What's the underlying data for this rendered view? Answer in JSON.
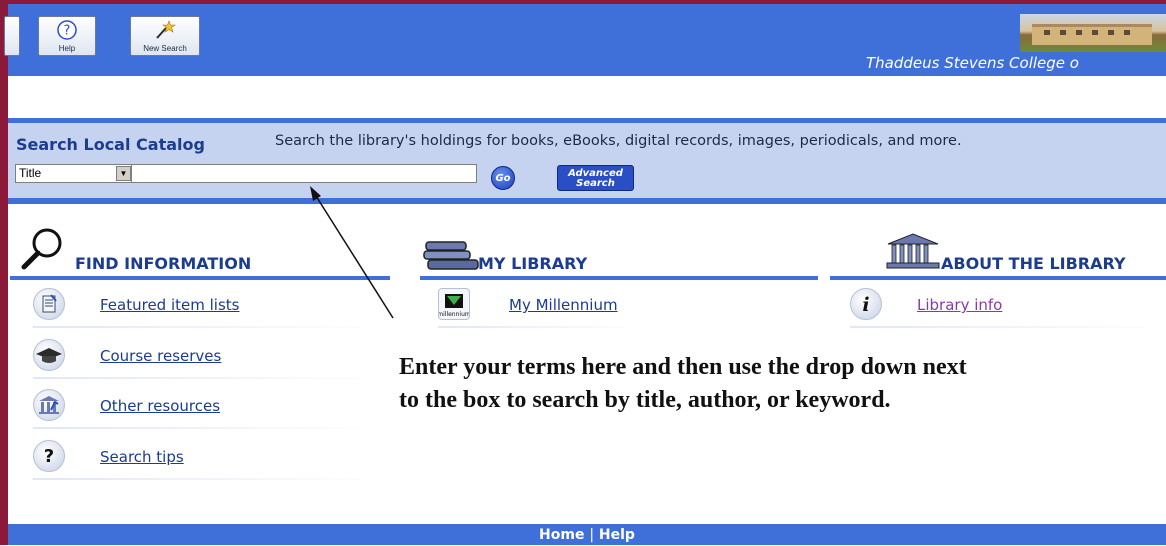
{
  "toolbar": {
    "help_label": "Help",
    "new_search_label": "New Search"
  },
  "header": {
    "college_name": "Thaddeus Stevens College o"
  },
  "search": {
    "title": "Search Local Catalog",
    "description": "Search the library's holdings for books, eBooks, digital records, images, periodicals, and more.",
    "field_selected": "Title",
    "query_value": "",
    "go_label": "Go",
    "advanced_label_line1": "Advanced",
    "advanced_label_line2": "Search"
  },
  "find_information": {
    "heading": "FIND INFORMATION",
    "items": [
      {
        "label": "Featured item lists",
        "icon": "list-icon"
      },
      {
        "label": "Course reserves",
        "icon": "graduation-cap-icon"
      },
      {
        "label": "Other resources",
        "icon": "library-building-icon"
      },
      {
        "label": "Search tips",
        "icon": "question-icon"
      }
    ]
  },
  "my_library": {
    "heading": "MY LIBRARY",
    "items": [
      {
        "label": "My Millennium",
        "icon": "millennium-icon"
      }
    ]
  },
  "about_library": {
    "heading": "ABOUT THE LIBRARY",
    "items": [
      {
        "label": "Library info",
        "icon": "info-icon"
      }
    ]
  },
  "annotation": {
    "text": "Enter your terms here and then use the drop down next to the box to search by title, author, or keyword."
  },
  "footer": {
    "home_label": "Home",
    "separator": "|",
    "help_label": "Help"
  },
  "colors": {
    "header_blue": "#3f6fd8",
    "panel_blue": "#c5d3f0",
    "heading_navy": "#1b3c8f",
    "frame_maroon": "#8b1a3a",
    "visited_link": "#8a3aa8"
  }
}
